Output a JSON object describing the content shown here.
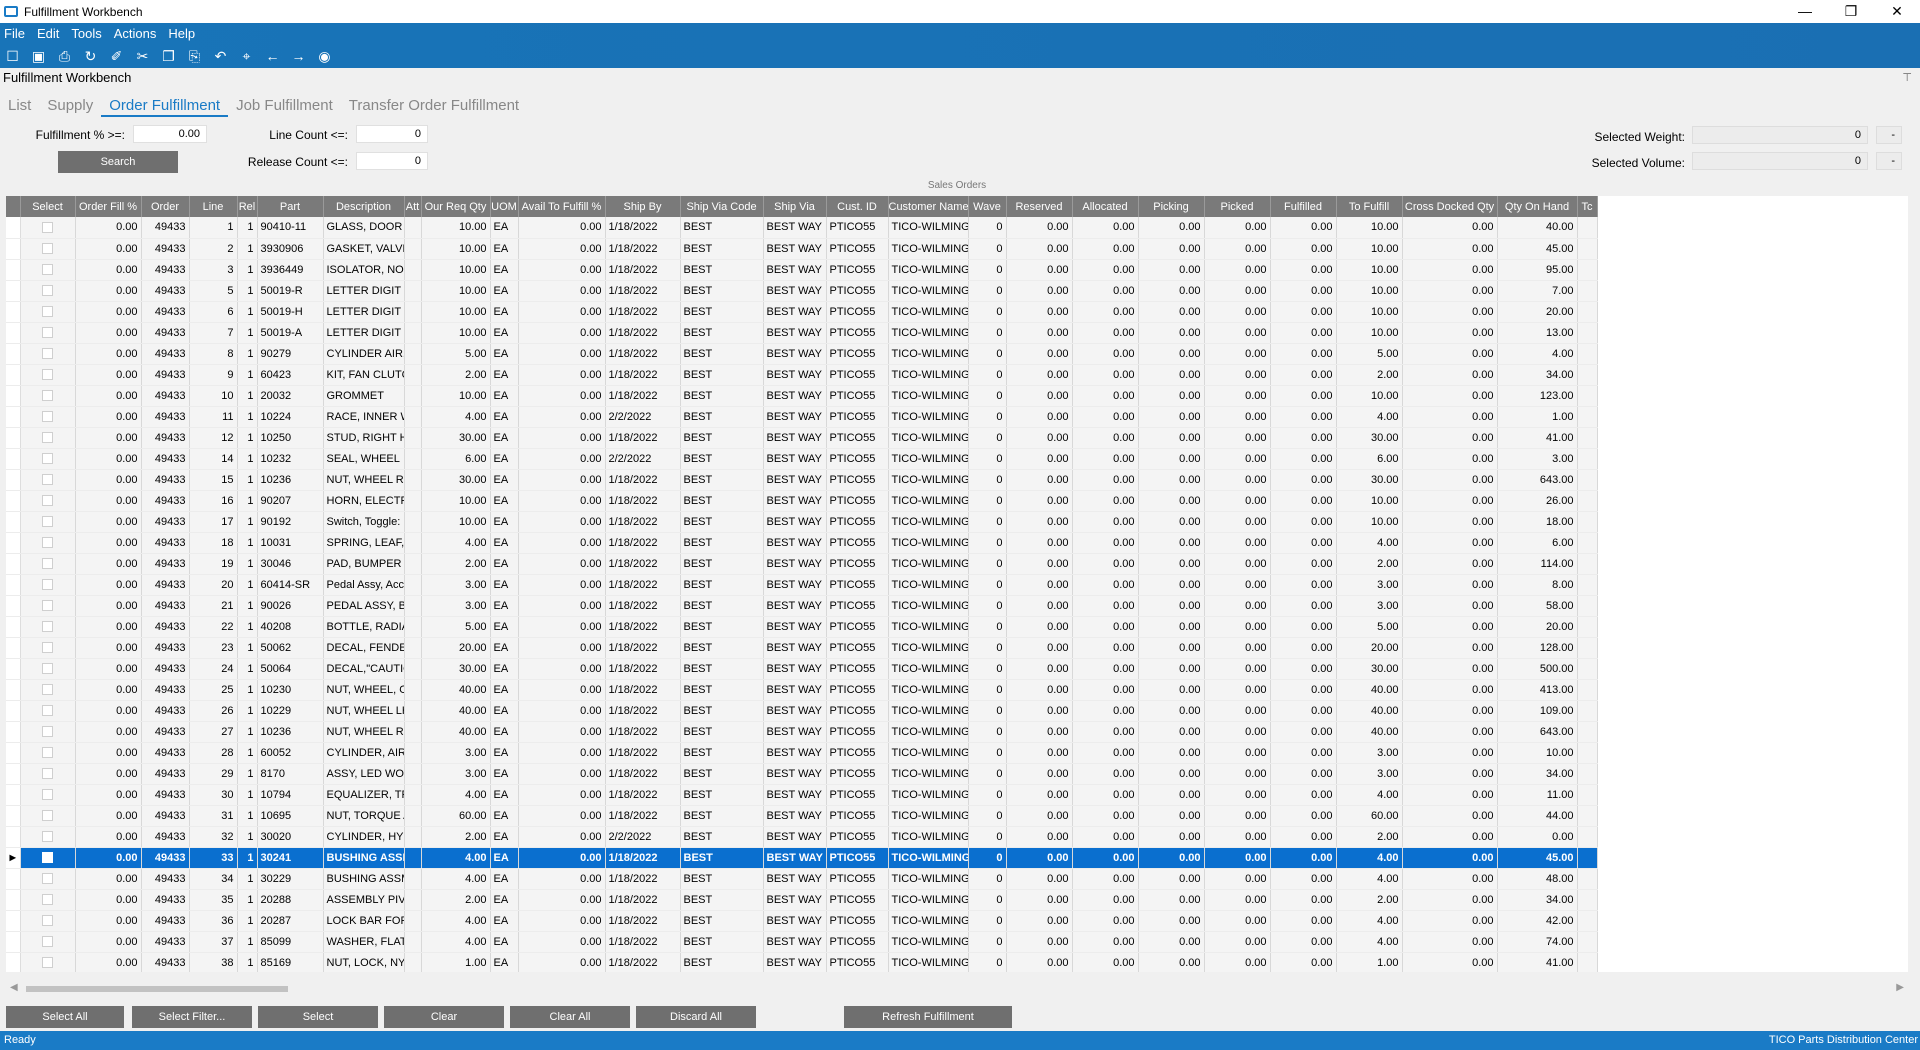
{
  "window": {
    "title": "Fulfillment Workbench"
  },
  "menu": [
    "File",
    "Edit",
    "Tools",
    "Actions",
    "Help"
  ],
  "toolbar_icons": [
    "new-icon",
    "save-icon",
    "print-icon",
    "refresh-icon",
    "clear-icon",
    "cut-icon",
    "copy-icon",
    "paste-icon",
    "undo-icon",
    "search-icon",
    "back-icon",
    "forward-icon",
    "stop-icon"
  ],
  "panel": {
    "title": "Fulfillment Workbench"
  },
  "tabs": [
    "List",
    "Supply",
    "Order Fulfillment",
    "Job Fulfillment",
    "Transfer Order Fulfillment"
  ],
  "filters": {
    "fulfillment_label": "Fulfillment % >=:",
    "fulfillment_value": "0.00",
    "line_count_label": "Line Count <=:",
    "line_count_value": "0",
    "release_count_label": "Release Count <=:",
    "release_count_value": "0",
    "search_label": "Search",
    "selected_weight_label": "Selected Weight:",
    "selected_weight_value": "0",
    "selected_volume_label": "Selected Volume:",
    "selected_volume_value": "0"
  },
  "grid": {
    "title": "Sales Orders",
    "columns": [
      "",
      "Select",
      "Order Fill %",
      "Order",
      "Line",
      "Rel",
      "Part",
      "Description",
      "Att",
      "Our Req Qty",
      "UOM",
      "Avail To Fulfill %",
      "Ship By",
      "Ship Via Code",
      "Ship Via",
      "Cust. ID",
      "Customer Name",
      "Wave",
      "Reserved",
      "Allocated",
      "Picking",
      "Picked",
      "Fulfilled",
      "To Fulfill",
      "Cross Docked Qty",
      "Qty On Hand",
      "Tc"
    ],
    "selected_row": 30,
    "rows": [
      [
        "0.00",
        "49433",
        "1",
        "1",
        "90410-11",
        "GLASS, DOOR (L",
        "",
        "10.00",
        "EA",
        "0.00",
        "1/18/2022",
        "BEST",
        "BEST WAY",
        "PTICO55",
        "TICO-WILMINGT",
        "0",
        "0.00",
        "0.00",
        "0.00",
        "0.00",
        "0.00",
        "10.00",
        "0.00",
        "40.00"
      ],
      [
        "0.00",
        "49433",
        "2",
        "1",
        "3930906",
        "GASKET, VALVE",
        "",
        "10.00",
        "EA",
        "0.00",
        "1/18/2022",
        "BEST",
        "BEST WAY",
        "PTICO55",
        "TICO-WILMINGT",
        "0",
        "0.00",
        "0.00",
        "0.00",
        "0.00",
        "0.00",
        "10.00",
        "0.00",
        "45.00"
      ],
      [
        "0.00",
        "49433",
        "3",
        "1",
        "3936449",
        "ISOLATOR, NOIS",
        "",
        "10.00",
        "EA",
        "0.00",
        "1/18/2022",
        "BEST",
        "BEST WAY",
        "PTICO55",
        "TICO-WILMINGT",
        "0",
        "0.00",
        "0.00",
        "0.00",
        "0.00",
        "0.00",
        "10.00",
        "0.00",
        "95.00"
      ],
      [
        "0.00",
        "49433",
        "5",
        "1",
        "50019-R",
        "LETTER DIGIT \"",
        "",
        "10.00",
        "EA",
        "0.00",
        "1/18/2022",
        "BEST",
        "BEST WAY",
        "PTICO55",
        "TICO-WILMINGT",
        "0",
        "0.00",
        "0.00",
        "0.00",
        "0.00",
        "0.00",
        "10.00",
        "0.00",
        "7.00"
      ],
      [
        "0.00",
        "49433",
        "6",
        "1",
        "50019-H",
        "LETTER DIGIT \"",
        "",
        "10.00",
        "EA",
        "0.00",
        "1/18/2022",
        "BEST",
        "BEST WAY",
        "PTICO55",
        "TICO-WILMINGT",
        "0",
        "0.00",
        "0.00",
        "0.00",
        "0.00",
        "0.00",
        "10.00",
        "0.00",
        "20.00"
      ],
      [
        "0.00",
        "49433",
        "7",
        "1",
        "50019-A",
        "LETTER DIGIT \"A",
        "",
        "10.00",
        "EA",
        "0.00",
        "1/18/2022",
        "BEST",
        "BEST WAY",
        "PTICO55",
        "TICO-WILMINGT",
        "0",
        "0.00",
        "0.00",
        "0.00",
        "0.00",
        "0.00",
        "10.00",
        "0.00",
        "13.00"
      ],
      [
        "0.00",
        "49433",
        "8",
        "1",
        "90279",
        "CYLINDER AIR,",
        "",
        "5.00",
        "EA",
        "0.00",
        "1/18/2022",
        "BEST",
        "BEST WAY",
        "PTICO55",
        "TICO-WILMINGT",
        "0",
        "0.00",
        "0.00",
        "0.00",
        "0.00",
        "0.00",
        "5.00",
        "0.00",
        "4.00"
      ],
      [
        "0.00",
        "49433",
        "9",
        "1",
        "60423",
        "KIT, FAN CLUTC",
        "",
        "2.00",
        "EA",
        "0.00",
        "1/18/2022",
        "BEST",
        "BEST WAY",
        "PTICO55",
        "TICO-WILMINGT",
        "0",
        "0.00",
        "0.00",
        "0.00",
        "0.00",
        "0.00",
        "2.00",
        "0.00",
        "34.00"
      ],
      [
        "0.00",
        "49433",
        "10",
        "1",
        "20032",
        "GROMMET",
        "",
        "10.00",
        "EA",
        "0.00",
        "1/18/2022",
        "BEST",
        "BEST WAY",
        "PTICO55",
        "TICO-WILMINGT",
        "0",
        "0.00",
        "0.00",
        "0.00",
        "0.00",
        "0.00",
        "10.00",
        "0.00",
        "123.00"
      ],
      [
        "0.00",
        "49433",
        "11",
        "1",
        "10224",
        "RACE, INNER W",
        "",
        "4.00",
        "EA",
        "0.00",
        "2/2/2022",
        "BEST",
        "BEST WAY",
        "PTICO55",
        "TICO-WILMINGT",
        "0",
        "0.00",
        "0.00",
        "0.00",
        "0.00",
        "0.00",
        "4.00",
        "0.00",
        "1.00"
      ],
      [
        "0.00",
        "49433",
        "12",
        "1",
        "10250",
        "STUD, RIGHT HA",
        "",
        "30.00",
        "EA",
        "0.00",
        "1/18/2022",
        "BEST",
        "BEST WAY",
        "PTICO55",
        "TICO-WILMINGT",
        "0",
        "0.00",
        "0.00",
        "0.00",
        "0.00",
        "0.00",
        "30.00",
        "0.00",
        "41.00"
      ],
      [
        "0.00",
        "49433",
        "14",
        "1",
        "10232",
        "SEAL, WHEEL",
        "",
        "6.00",
        "EA",
        "0.00",
        "2/2/2022",
        "BEST",
        "BEST WAY",
        "PTICO55",
        "TICO-WILMINGT",
        "0",
        "0.00",
        "0.00",
        "0.00",
        "0.00",
        "0.00",
        "6.00",
        "0.00",
        "3.00"
      ],
      [
        "0.00",
        "49433",
        "15",
        "1",
        "10236",
        "NUT, WHEEL RH",
        "",
        "30.00",
        "EA",
        "0.00",
        "1/18/2022",
        "BEST",
        "BEST WAY",
        "PTICO55",
        "TICO-WILMINGT",
        "0",
        "0.00",
        "0.00",
        "0.00",
        "0.00",
        "0.00",
        "30.00",
        "0.00",
        "643.00"
      ],
      [
        "0.00",
        "49433",
        "16",
        "1",
        "90207",
        "HORN, ELECTRI",
        "",
        "10.00",
        "EA",
        "0.00",
        "1/18/2022",
        "BEST",
        "BEST WAY",
        "PTICO55",
        "TICO-WILMINGT",
        "0",
        "0.00",
        "0.00",
        "0.00",
        "0.00",
        "0.00",
        "10.00",
        "0.00",
        "26.00"
      ],
      [
        "0.00",
        "49433",
        "17",
        "1",
        "90192",
        "Switch, Toggle: H",
        "",
        "10.00",
        "EA",
        "0.00",
        "1/18/2022",
        "BEST",
        "BEST WAY",
        "PTICO55",
        "TICO-WILMINGT",
        "0",
        "0.00",
        "0.00",
        "0.00",
        "0.00",
        "0.00",
        "10.00",
        "0.00",
        "18.00"
      ],
      [
        "0.00",
        "49433",
        "18",
        "1",
        "10031",
        "SPRING, LEAF, F",
        "",
        "4.00",
        "EA",
        "0.00",
        "1/18/2022",
        "BEST",
        "BEST WAY",
        "PTICO55",
        "TICO-WILMINGT",
        "0",
        "0.00",
        "0.00",
        "0.00",
        "0.00",
        "0.00",
        "4.00",
        "0.00",
        "6.00"
      ],
      [
        "0.00",
        "49433",
        "19",
        "1",
        "30046",
        "PAD, BUMPER",
        "",
        "2.00",
        "EA",
        "0.00",
        "1/18/2022",
        "BEST",
        "BEST WAY",
        "PTICO55",
        "TICO-WILMINGT",
        "0",
        "0.00",
        "0.00",
        "0.00",
        "0.00",
        "0.00",
        "2.00",
        "0.00",
        "114.00"
      ],
      [
        "0.00",
        "49433",
        "20",
        "1",
        "60414-SR",
        "Pedal Assy, Accel",
        "",
        "3.00",
        "EA",
        "0.00",
        "1/18/2022",
        "BEST",
        "BEST WAY",
        "PTICO55",
        "TICO-WILMINGT",
        "0",
        "0.00",
        "0.00",
        "0.00",
        "0.00",
        "0.00",
        "3.00",
        "0.00",
        "8.00"
      ],
      [
        "0.00",
        "49433",
        "21",
        "1",
        "90026",
        "PEDAL ASSY, BR",
        "",
        "3.00",
        "EA",
        "0.00",
        "1/18/2022",
        "BEST",
        "BEST WAY",
        "PTICO55",
        "TICO-WILMINGT",
        "0",
        "0.00",
        "0.00",
        "0.00",
        "0.00",
        "0.00",
        "3.00",
        "0.00",
        "58.00"
      ],
      [
        "0.00",
        "49433",
        "22",
        "1",
        "40208",
        "BOTTLE, RADIAT",
        "",
        "5.00",
        "EA",
        "0.00",
        "1/18/2022",
        "BEST",
        "BEST WAY",
        "PTICO55",
        "TICO-WILMINGT",
        "0",
        "0.00",
        "0.00",
        "0.00",
        "0.00",
        "0.00",
        "5.00",
        "0.00",
        "20.00"
      ],
      [
        "0.00",
        "49433",
        "23",
        "1",
        "50062",
        "DECAL, FENDER",
        "",
        "20.00",
        "EA",
        "0.00",
        "1/18/2022",
        "BEST",
        "BEST WAY",
        "PTICO55",
        "TICO-WILMINGT",
        "0",
        "0.00",
        "0.00",
        "0.00",
        "0.00",
        "0.00",
        "20.00",
        "0.00",
        "128.00"
      ],
      [
        "0.00",
        "49433",
        "24",
        "1",
        "50064",
        "DECAL,\"CAUTIO",
        "",
        "30.00",
        "EA",
        "0.00",
        "1/18/2022",
        "BEST",
        "BEST WAY",
        "PTICO55",
        "TICO-WILMINGT",
        "0",
        "0.00",
        "0.00",
        "0.00",
        "0.00",
        "0.00",
        "30.00",
        "0.00",
        "500.00"
      ],
      [
        "0.00",
        "49433",
        "25",
        "1",
        "10230",
        "NUT, WHEEL, O",
        "",
        "40.00",
        "EA",
        "0.00",
        "1/18/2022",
        "BEST",
        "BEST WAY",
        "PTICO55",
        "TICO-WILMINGT",
        "0",
        "0.00",
        "0.00",
        "0.00",
        "0.00",
        "0.00",
        "40.00",
        "0.00",
        "413.00"
      ],
      [
        "0.00",
        "49433",
        "26",
        "1",
        "10229",
        "NUT, WHEEL LH",
        "",
        "40.00",
        "EA",
        "0.00",
        "1/18/2022",
        "BEST",
        "BEST WAY",
        "PTICO55",
        "TICO-WILMINGT",
        "0",
        "0.00",
        "0.00",
        "0.00",
        "0.00",
        "0.00",
        "40.00",
        "0.00",
        "109.00"
      ],
      [
        "0.00",
        "49433",
        "27",
        "1",
        "10236",
        "NUT, WHEEL RH",
        "",
        "40.00",
        "EA",
        "0.00",
        "1/18/2022",
        "BEST",
        "BEST WAY",
        "PTICO55",
        "TICO-WILMINGT",
        "0",
        "0.00",
        "0.00",
        "0.00",
        "0.00",
        "0.00",
        "40.00",
        "0.00",
        "643.00"
      ],
      [
        "0.00",
        "49433",
        "28",
        "1",
        "60052",
        "CYLINDER, AIR",
        "",
        "3.00",
        "EA",
        "0.00",
        "1/18/2022",
        "BEST",
        "BEST WAY",
        "PTICO55",
        "TICO-WILMINGT",
        "0",
        "0.00",
        "0.00",
        "0.00",
        "0.00",
        "0.00",
        "3.00",
        "0.00",
        "10.00"
      ],
      [
        "0.00",
        "49433",
        "29",
        "1",
        "8170",
        "ASSY, LED WOR",
        "",
        "3.00",
        "EA",
        "0.00",
        "1/18/2022",
        "BEST",
        "BEST WAY",
        "PTICO55",
        "TICO-WILMINGT",
        "0",
        "0.00",
        "0.00",
        "0.00",
        "0.00",
        "0.00",
        "3.00",
        "0.00",
        "34.00"
      ],
      [
        "0.00",
        "49433",
        "30",
        "1",
        "10794",
        "EQUALIZER, TR",
        "",
        "4.00",
        "EA",
        "0.00",
        "1/18/2022",
        "BEST",
        "BEST WAY",
        "PTICO55",
        "TICO-WILMINGT",
        "0",
        "0.00",
        "0.00",
        "0.00",
        "0.00",
        "0.00",
        "4.00",
        "0.00",
        "11.00"
      ],
      [
        "0.00",
        "49433",
        "31",
        "1",
        "10695",
        "NUT, TORQUE A",
        "",
        "60.00",
        "EA",
        "0.00",
        "1/18/2022",
        "BEST",
        "BEST WAY",
        "PTICO55",
        "TICO-WILMINGT",
        "0",
        "0.00",
        "0.00",
        "0.00",
        "0.00",
        "0.00",
        "60.00",
        "0.00",
        "44.00"
      ],
      [
        "0.00",
        "49433",
        "32",
        "1",
        "30020",
        "CYLINDER, HYD",
        "",
        "2.00",
        "EA",
        "0.00",
        "2/2/2022",
        "BEST",
        "BEST WAY",
        "PTICO55",
        "TICO-WILMINGT",
        "0",
        "0.00",
        "0.00",
        "0.00",
        "0.00",
        "0.00",
        "2.00",
        "0.00",
        "0.00"
      ],
      [
        "0.00",
        "49433",
        "33",
        "1",
        "30241",
        "BUSHING ASSE",
        "",
        "4.00",
        "EA",
        "0.00",
        "1/18/2022",
        "BEST",
        "BEST WAY",
        "PTICO55",
        "TICO-WILMINGT",
        "0",
        "0.00",
        "0.00",
        "0.00",
        "0.00",
        "0.00",
        "4.00",
        "0.00",
        "45.00"
      ],
      [
        "0.00",
        "49433",
        "34",
        "1",
        "30229",
        "BUSHING ASSM",
        "",
        "4.00",
        "EA",
        "0.00",
        "1/18/2022",
        "BEST",
        "BEST WAY",
        "PTICO55",
        "TICO-WILMINGT",
        "0",
        "0.00",
        "0.00",
        "0.00",
        "0.00",
        "0.00",
        "4.00",
        "0.00",
        "48.00"
      ],
      [
        "0.00",
        "49433",
        "35",
        "1",
        "20288",
        "ASSEMBLY PIVO",
        "",
        "2.00",
        "EA",
        "0.00",
        "1/18/2022",
        "BEST",
        "BEST WAY",
        "PTICO55",
        "TICO-WILMINGT",
        "0",
        "0.00",
        "0.00",
        "0.00",
        "0.00",
        "0.00",
        "2.00",
        "0.00",
        "34.00"
      ],
      [
        "0.00",
        "49433",
        "36",
        "1",
        "20287",
        "LOCK BAR FOR",
        "",
        "4.00",
        "EA",
        "0.00",
        "1/18/2022",
        "BEST",
        "BEST WAY",
        "PTICO55",
        "TICO-WILMINGT",
        "0",
        "0.00",
        "0.00",
        "0.00",
        "0.00",
        "0.00",
        "4.00",
        "0.00",
        "42.00"
      ],
      [
        "0.00",
        "49433",
        "37",
        "1",
        "85099",
        "WASHER, FLAT,",
        "",
        "4.00",
        "EA",
        "0.00",
        "1/18/2022",
        "BEST",
        "BEST WAY",
        "PTICO55",
        "TICO-WILMINGT",
        "0",
        "0.00",
        "0.00",
        "0.00",
        "0.00",
        "0.00",
        "4.00",
        "0.00",
        "74.00"
      ],
      [
        "0.00",
        "49433",
        "38",
        "1",
        "85169",
        "NUT, LOCK, NYL",
        "",
        "1.00",
        "EA",
        "0.00",
        "1/18/2022",
        "BEST",
        "BEST WAY",
        "PTICO55",
        "TICO-WILMINGT",
        "0",
        "0.00",
        "0.00",
        "0.00",
        "0.00",
        "0.00",
        "1.00",
        "0.00",
        "41.00"
      ]
    ]
  },
  "buttons": {
    "select_all": "Select All",
    "select_filter": "Select Filter...",
    "select": "Select",
    "clear": "Clear",
    "clear_all": "Clear All",
    "discard_all": "Discard All",
    "refresh": "Refresh Fulfillment"
  },
  "status": {
    "left": "Ready",
    "right": "TICO Parts Distribution Center"
  }
}
